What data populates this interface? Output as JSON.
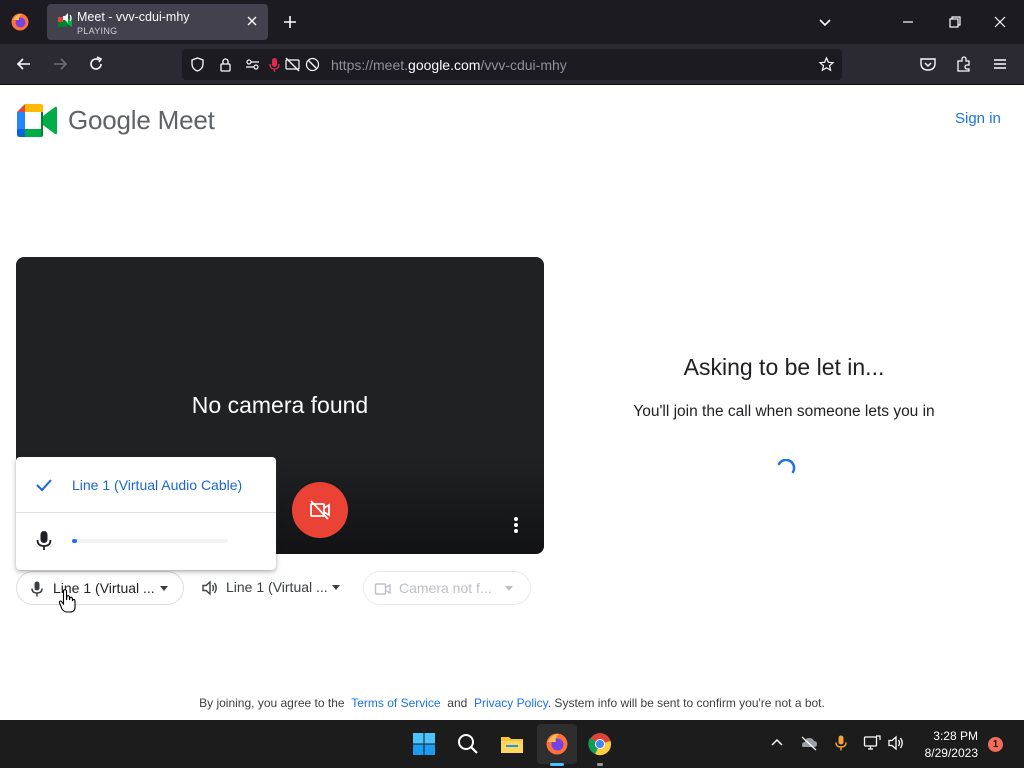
{
  "browser": {
    "tab": {
      "title": "Meet - vvv-cdui-mhy",
      "status": "PLAYING"
    },
    "url": {
      "prefix": "https://meet.",
      "domain": "google.com",
      "path": "/vvv-cdui-mhy"
    }
  },
  "header": {
    "logo_text": "Google Meet",
    "signin_label": "Sign in"
  },
  "preview": {
    "message": "No camera found"
  },
  "lobby": {
    "title": "Asking to be let in...",
    "subtitle": "You'll join the call when someone lets you in"
  },
  "mic_menu": {
    "selected_option": "Line 1 (Virtual Audio Cable)",
    "level": 0.03
  },
  "devices": {
    "mic_label": "Line 1 (Virtual ...",
    "speaker_label": "Line 1 (Virtual ...",
    "camera_label": "Camera not f..."
  },
  "footer": {
    "prefix": "By joining, you agree to the",
    "terms": "Terms of Service",
    "and": "and",
    "privacy": "Privacy Policy",
    "suffix": ". System info will be sent to confirm you're not a bot."
  },
  "taskbar": {
    "time": "3:28 PM",
    "date": "8/29/2023",
    "notification_count": "1"
  },
  "colors": {
    "meet_blue": "#1a73e8",
    "cam_off_red": "#ea4335",
    "chrome_dark": "#1c1b22",
    "taskbar": "#1c1c1c"
  }
}
